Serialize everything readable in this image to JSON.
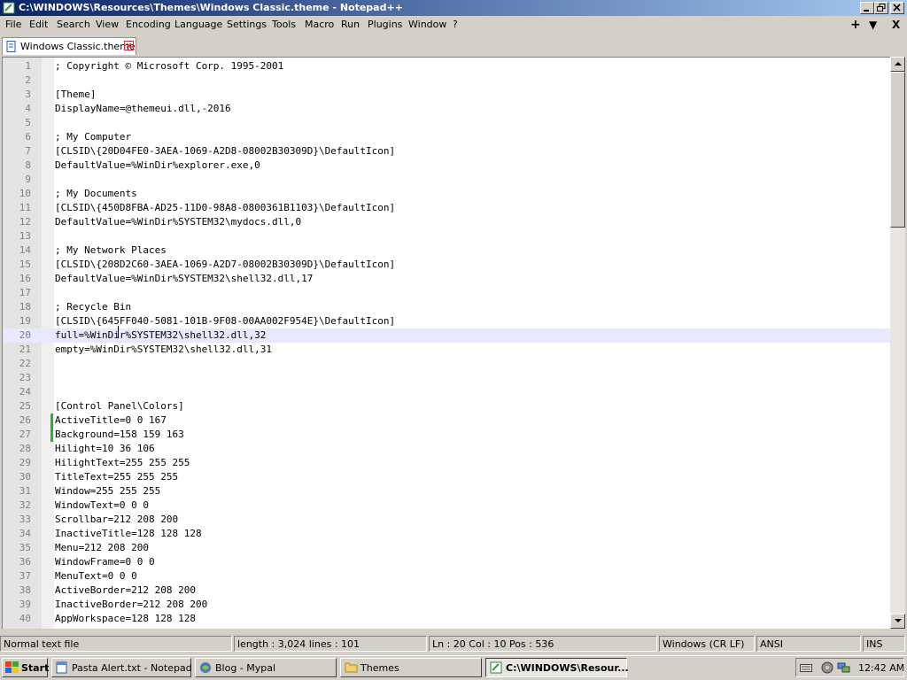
{
  "window": {
    "title": "C:\\WINDOWS\\Resources\\Themes\\Windows Classic.theme - Notepad++"
  },
  "menu": {
    "items": [
      "File",
      "Edit",
      "Search",
      "View",
      "Encoding",
      "Language",
      "Settings",
      "Tools",
      "Macro",
      "Run",
      "Plugins",
      "Window",
      "?"
    ],
    "right_plus": "+",
    "right_down": "▼",
    "right_close": "X"
  },
  "tab": {
    "label": "Windows Classic.theme"
  },
  "editor": {
    "current_line": 20,
    "changed_lines": [
      26,
      27
    ],
    "lines": [
      "; Copyright © Microsoft Corp. 1995-2001",
      "",
      "[Theme]",
      "DisplayName=@themeui.dll,-2016",
      "",
      "; My Computer",
      "[CLSID\\{20D04FE0-3AEA-1069-A2D8-08002B30309D}\\DefaultIcon]",
      "DefaultValue=%WinDir%explorer.exe,0",
      "",
      "; My Documents",
      "[CLSID\\{450D8FBA-AD25-11D0-98A8-0800361B1103}\\DefaultIcon]",
      "DefaultValue=%WinDir%SYSTEM32\\mydocs.dll,0",
      "",
      "; My Network Places",
      "[CLSID\\{208D2C60-3AEA-1069-A2D7-08002B30309D}\\DefaultIcon]",
      "DefaultValue=%WinDir%SYSTEM32\\shell32.dll,17",
      "",
      "; Recycle Bin",
      "[CLSID\\{645FF040-5081-101B-9F08-00AA002F954E}\\DefaultIcon]",
      "full=%WinDir%SYSTEM32\\shell32.dll,32",
      "empty=%WinDir%SYSTEM32\\shell32.dll,31",
      "",
      "",
      "",
      "[Control Panel\\Colors]",
      "ActiveTitle=0 0 167",
      "Background=158 159 163",
      "Hilight=10 36 106",
      "HilightText=255 255 255",
      "TitleText=255 255 255",
      "Window=255 255 255",
      "WindowText=0 0 0",
      "Scrollbar=212 208 200",
      "InactiveTitle=128 128 128",
      "Menu=212 208 200",
      "WindowFrame=0 0 0",
      "MenuText=0 0 0",
      "ActiveBorder=212 208 200",
      "InactiveBorder=212 208 200",
      "AppWorkspace=128 128 128"
    ]
  },
  "status": {
    "filetype": "Normal text file",
    "length_lines": "length : 3,024    lines : 101",
    "position": "Ln : 20    Col : 10    Pos : 536",
    "eol": "Windows (CR LF)",
    "encoding": "ANSI",
    "mode": "INS"
  },
  "taskbar": {
    "start_label": "Start",
    "tasks": [
      {
        "label": "Pasta Alert.txt - Notepad",
        "icon": "notepad-icon"
      },
      {
        "label": "Blog - Mypal",
        "icon": "browser-icon"
      },
      {
        "label": "Themes",
        "icon": "folder-icon"
      },
      {
        "label": "C:\\WINDOWS\\Resour...",
        "icon": "notepadpp-icon"
      }
    ],
    "clock": "12:42 AM"
  },
  "colors": {
    "titlebar_start": "#0a246a",
    "titlebar_end": "#a6caf0",
    "current_line": "#e8e8ff",
    "change_marker": "#30b030",
    "face": "#d4d0c8"
  }
}
